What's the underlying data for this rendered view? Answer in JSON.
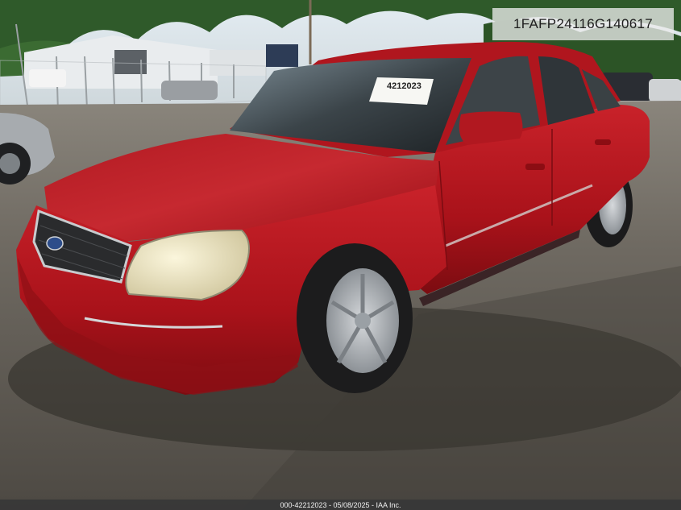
{
  "photo": {
    "description_subject": "red-sedan",
    "vin_badge": "1FAFP24116G140617",
    "footer_text": "000-42212023 - 05/08/2025 - IAA Inc.",
    "windshield_sticker": "4212023"
  },
  "colors": {
    "car_body": "#b5141c",
    "car_body_shadow": "#7d0d12",
    "gravel": "#6e6a63",
    "sky": "#d7e3ea",
    "trees": "#2f5a2a"
  }
}
